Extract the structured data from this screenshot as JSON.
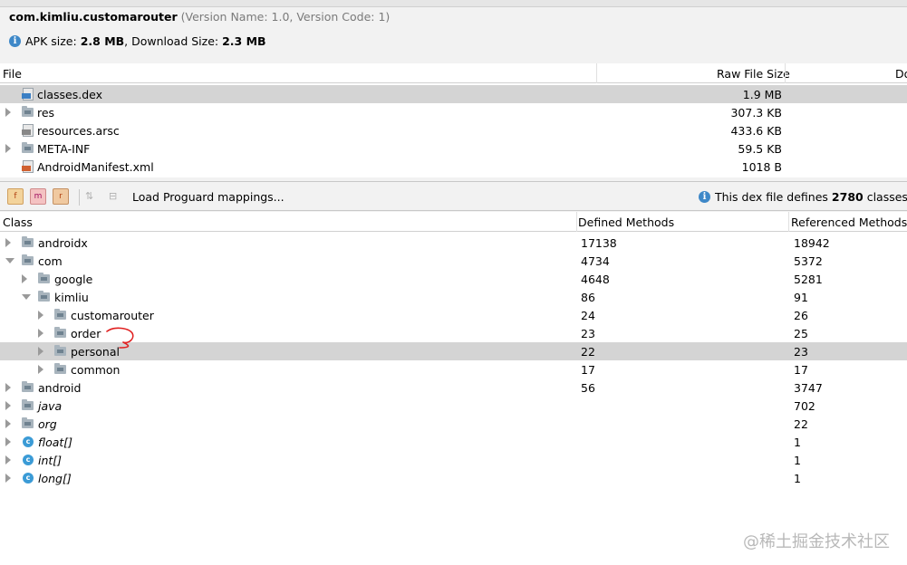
{
  "header": {
    "package": "com.kimliu.customarouter",
    "version_info": "(Version Name: 1.0, Version Code: 1)",
    "apk_size_label": "APK size:",
    "apk_size_value": "2.8 MB",
    "download_size_label": ", Download Size:",
    "download_size_value": "2.3 MB"
  },
  "files": {
    "headers": [
      "File",
      "Raw File Size",
      "Do"
    ],
    "rows": [
      {
        "name": "classes.dex",
        "size": "1.9 MB",
        "icon": "dex-file-icon",
        "expandable": false,
        "selected": true
      },
      {
        "name": "res",
        "size": "307.3 KB",
        "icon": "folder-icon",
        "expandable": true,
        "selected": false
      },
      {
        "name": "resources.arsc",
        "size": "433.6 KB",
        "icon": "arsc-file-icon",
        "expandable": false,
        "selected": false
      },
      {
        "name": "META-INF",
        "size": "59.5 KB",
        "icon": "folder-icon",
        "expandable": true,
        "selected": false
      },
      {
        "name": "AndroidManifest.xml",
        "size": "1018 B",
        "icon": "xml-file-icon",
        "expandable": false,
        "selected": false
      }
    ]
  },
  "toolbar": {
    "btn_f": "f",
    "btn_m": "m",
    "btn_r": "r",
    "load_label": "Load Proguard mappings...",
    "info_prefix": "This dex file defines",
    "info_count": "2780",
    "info_suffix": "classes wit"
  },
  "classes": {
    "headers": [
      "Class",
      "Defined Methods",
      "Referenced Methods"
    ],
    "rows": [
      {
        "name": "androidx",
        "defined": "17138",
        "referenced": "18942",
        "icon": "package-icon",
        "expand": "collapsed",
        "italic": false,
        "selected": false
      },
      {
        "name": "com",
        "defined": "4734",
        "referenced": "5372",
        "icon": "package-icon",
        "expand": "expanded",
        "italic": false,
        "selected": false
      },
      {
        "name": "google",
        "defined": "4648",
        "referenced": "5281",
        "icon": "package-icon",
        "expand": "collapsed",
        "italic": false,
        "selected": false
      },
      {
        "name": "kimliu",
        "defined": "86",
        "referenced": "91",
        "icon": "package-icon",
        "expand": "expanded",
        "italic": false,
        "selected": false
      },
      {
        "name": "customarouter",
        "defined": "24",
        "referenced": "26",
        "icon": "package-icon",
        "expand": "collapsed",
        "italic": false,
        "selected": false
      },
      {
        "name": "order",
        "defined": "23",
        "referenced": "25",
        "icon": "package-icon",
        "expand": "collapsed",
        "italic": false,
        "selected": false
      },
      {
        "name": "personal",
        "defined": "22",
        "referenced": "23",
        "icon": "package-icon",
        "expand": "collapsed",
        "italic": false,
        "selected": true
      },
      {
        "name": "common",
        "defined": "17",
        "referenced": "17",
        "icon": "package-icon",
        "expand": "collapsed",
        "italic": false,
        "selected": false
      },
      {
        "name": "android",
        "defined": "56",
        "referenced": "3747",
        "icon": "package-icon",
        "expand": "collapsed",
        "italic": false,
        "selected": false
      },
      {
        "name": "java",
        "defined": "",
        "referenced": "702",
        "icon": "package-icon",
        "expand": "collapsed",
        "italic": true,
        "selected": false
      },
      {
        "name": "org",
        "defined": "",
        "referenced": "22",
        "icon": "package-icon",
        "expand": "collapsed",
        "italic": true,
        "selected": false
      },
      {
        "name": "float[]",
        "defined": "",
        "referenced": "1",
        "icon": "class-icon",
        "expand": "collapsed",
        "italic": true,
        "selected": false
      },
      {
        "name": "int[]",
        "defined": "",
        "referenced": "1",
        "icon": "class-icon",
        "expand": "collapsed",
        "italic": true,
        "selected": false
      },
      {
        "name": "long[]",
        "defined": "",
        "referenced": "1",
        "icon": "class-icon",
        "expand": "collapsed",
        "italic": true,
        "selected": false
      }
    ]
  },
  "class_icon_letter": "c",
  "watermark": "@稀土掘金技术社区",
  "colors": {
    "selection": "#d4d4d4",
    "info": "#3e88c8",
    "annotation": "#e02020"
  }
}
